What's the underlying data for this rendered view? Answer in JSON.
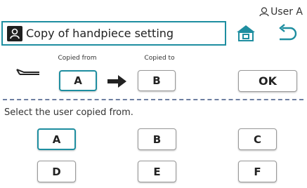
{
  "user": {
    "label": "User A"
  },
  "header": {
    "title": "Copy of handpiece setting"
  },
  "copy": {
    "from_label": "Copied from",
    "to_label": "Copied to",
    "from_value": "A",
    "to_value": "B",
    "ok_label": "OK"
  },
  "instruction": "Select the user copied from.",
  "users": [
    {
      "label": "A",
      "selected": true
    },
    {
      "label": "B",
      "selected": false
    },
    {
      "label": "C",
      "selected": false
    },
    {
      "label": "D",
      "selected": false
    },
    {
      "label": "E",
      "selected": false
    },
    {
      "label": "F",
      "selected": false
    }
  ],
  "colors": {
    "accent": "#1e8ea0",
    "icon": "#1e8ea0",
    "dash": "#6d7ea1",
    "text": "#222222"
  },
  "icons": [
    "user-icon",
    "home-icon",
    "back-arrow-icon",
    "handpiece-icon",
    "arrow-right-icon"
  ]
}
